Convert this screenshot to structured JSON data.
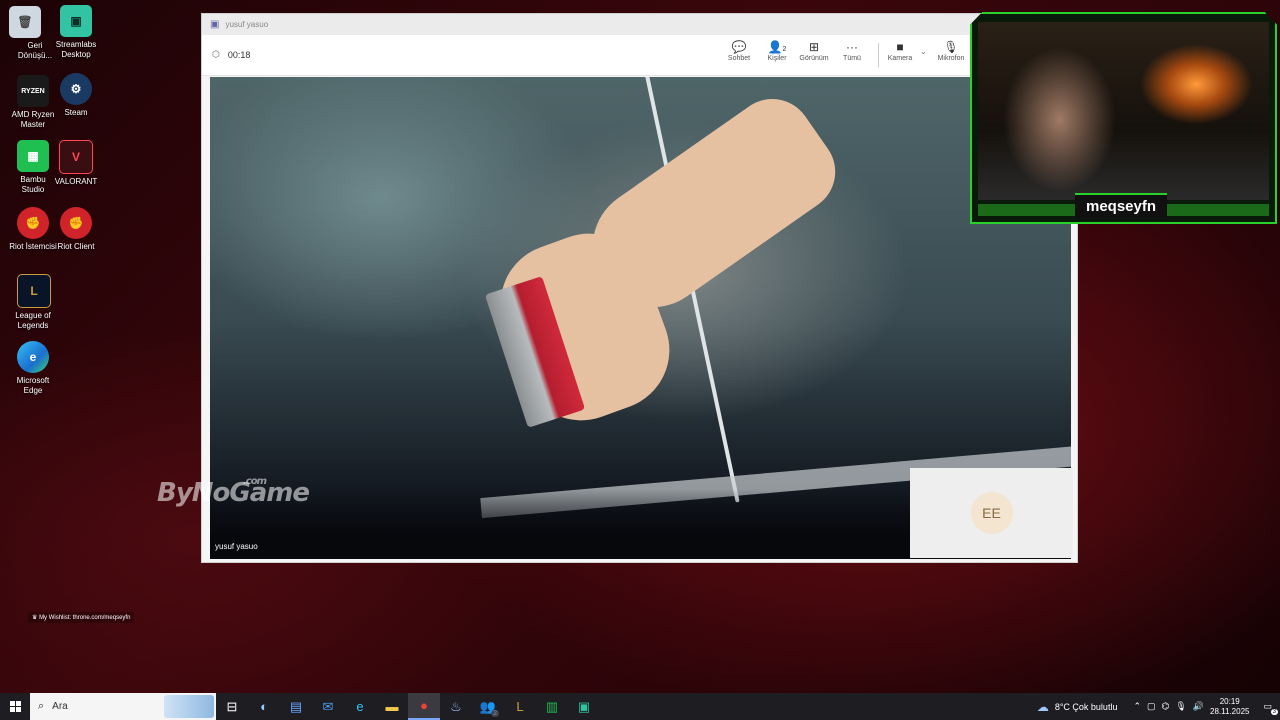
{
  "desktop": {
    "icons": [
      {
        "label": "Geri Dönüşü...",
        "glyph": "🗑"
      },
      {
        "label": "Streamlabs Desktop",
        "glyph": "▣"
      },
      {
        "label": "AMD Ryzen Master",
        "glyph": "RYZEN"
      },
      {
        "label": "Steam",
        "glyph": "⚙"
      },
      {
        "label": "Bambu Studio",
        "glyph": "▦"
      },
      {
        "label": "VALORANT",
        "glyph": "V"
      },
      {
        "label": "Riot İstemcisi",
        "glyph": "✊"
      },
      {
        "label": "Riot Client",
        "glyph": "✊"
      },
      {
        "label": "League of Legends",
        "glyph": "L"
      },
      {
        "label": "Microsoft Edge",
        "glyph": "e"
      }
    ]
  },
  "teams": {
    "window_title": "yusuf yasuo",
    "timer": "00:18",
    "toolbar": [
      {
        "label": "Sohbet",
        "icon": "💬"
      },
      {
        "label": "Kişiler",
        "icon": "👤",
        "badge": "2"
      },
      {
        "label": "Görünüm",
        "icon": "⊞"
      },
      {
        "label": "Tümü",
        "icon": "···"
      },
      {
        "label": "Kamera",
        "icon": "■"
      },
      {
        "label": "Mikrofon",
        "icon": "🎙"
      }
    ],
    "participant_name": "yusuf yasuo",
    "pip_initials": "EE"
  },
  "stream_overlay": {
    "streamer_name": "meqseyfn",
    "watermark": "ByNoGame",
    "watermark_suffix": ".com",
    "wishlist": "My Wishlist: throne.com/meqseyfn"
  },
  "taskbar": {
    "search_placeholder": "Ara",
    "apps": [
      "⊟",
      "◐",
      "▤",
      "✉",
      "e",
      "▬",
      "●",
      "♨",
      "👥",
      "L",
      "▥",
      "▣"
    ],
    "active_app_index": 6,
    "teams_badge": "2",
    "weather": "8°C  Çok bulutlu",
    "time": "20:19",
    "date": "28.11.2025",
    "notifications": "3"
  },
  "colors": {
    "overlay_green": "#2ad12a",
    "taskbar_bg": "#1e1e22",
    "desktop_red": "#3a060b"
  }
}
